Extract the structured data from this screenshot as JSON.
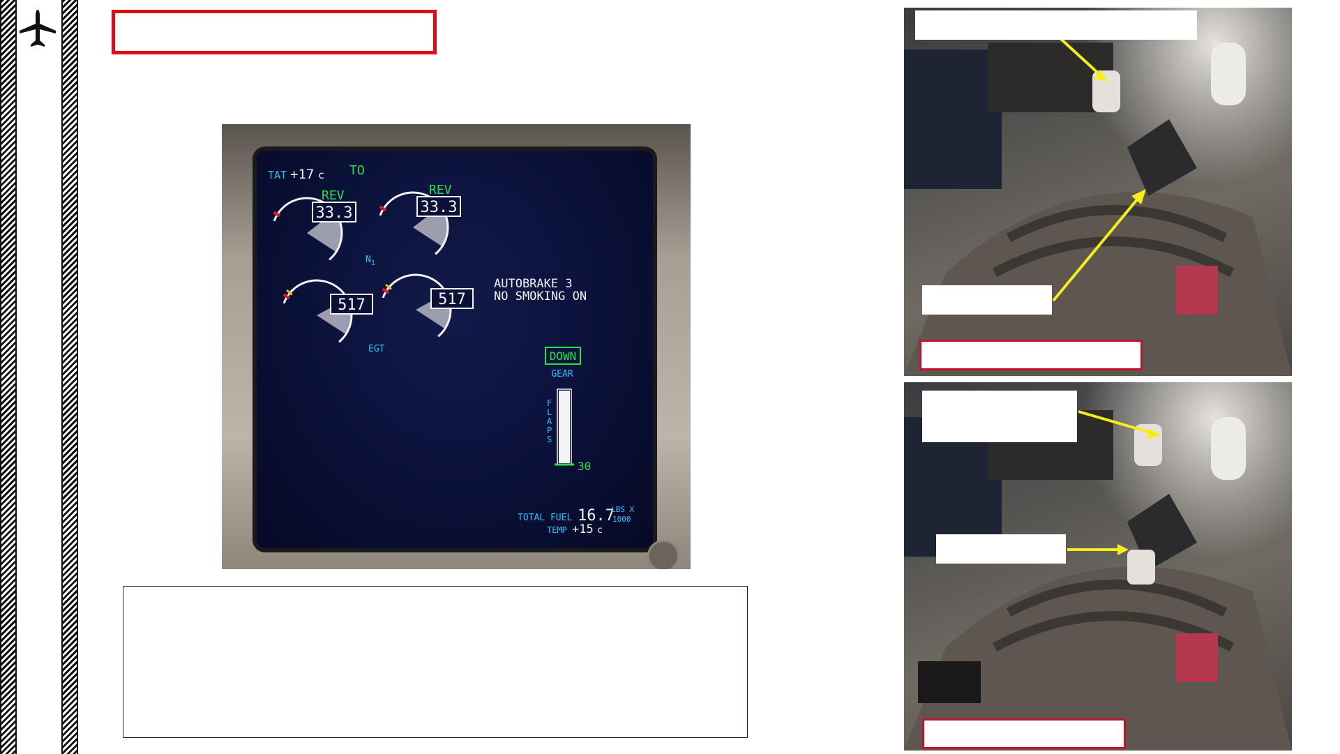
{
  "eicas": {
    "tat_label": "TAT",
    "tat_value": "+17",
    "tat_unit": "c",
    "thrust_mode": "TO",
    "n1": {
      "label": "N",
      "label_sub": "1",
      "left": {
        "status": "REV",
        "value": "33.3",
        "fill_fraction": 0.28
      },
      "right": {
        "status": "REV",
        "value": "33.3",
        "fill_fraction": 0.28
      }
    },
    "egt": {
      "label": "EGT",
      "left": {
        "value": "517",
        "fill_fraction": 0.42
      },
      "right": {
        "value": "517",
        "fill_fraction": 0.42
      }
    },
    "messages": [
      "AUTOBRAKE 3",
      "NO SMOKING ON"
    ],
    "gear_status": "DOWN",
    "gear_label": "GEAR",
    "flaps_label": "FLAPS",
    "flaps_value": "30",
    "flaps_fraction": 1.0,
    "total_fuel_label": "TOTAL FUEL",
    "total_fuel_value": "16.7",
    "fuel_unit_1": "LBS X",
    "fuel_unit_2": "1000",
    "temp_label": "TEMP",
    "temp_value": "+15",
    "temp_unit": "c"
  },
  "colors": {
    "cyan": "#27c4ff",
    "green": "#25e24a",
    "white": "#f4f4f4",
    "gauge_fill": "#9d9db0",
    "title_border": "#e00b14",
    "annotation_arrow": "#f5ee1a"
  },
  "icons": {
    "page_marker": "airplane-icon"
  }
}
